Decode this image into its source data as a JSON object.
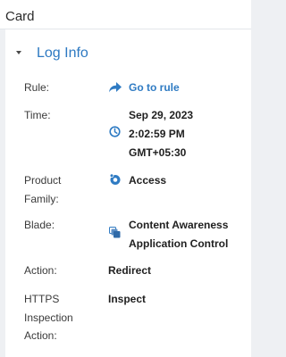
{
  "card": {
    "title": "Card"
  },
  "section": {
    "title": "Log Info"
  },
  "rows": {
    "rule": {
      "label": "Rule:",
      "value": "Go to rule"
    },
    "time": {
      "label": "Time:",
      "date": "Sep 29, 2023",
      "clock": "2:02:59 PM",
      "tz": "GMT+05:30"
    },
    "product_family": {
      "label_line1": "Product",
      "label_line2": "Family:",
      "value": "Access"
    },
    "blade": {
      "label": "Blade:",
      "line1": "Content Awareness",
      "line2": "Application Control"
    },
    "action": {
      "label": "Action:",
      "value": "Redirect"
    },
    "https": {
      "label_line1": "HTTPS",
      "label_line2": "Inspection",
      "label_line3": "Action:",
      "value": "Inspect"
    }
  },
  "icons": {
    "rule": "arrow-forward-icon",
    "time": "clock-icon",
    "product_family": "access-icon",
    "blade": "blade-icon"
  },
  "colors": {
    "link": "#2f7bc3",
    "section_title": "#2d79c2",
    "background": "#eef0f3"
  }
}
